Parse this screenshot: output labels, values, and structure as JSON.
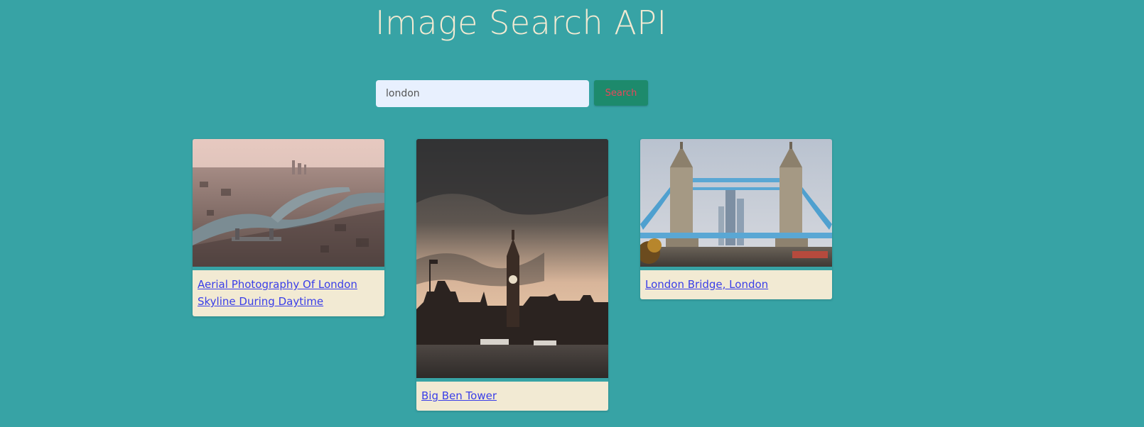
{
  "page": {
    "title": "Image Search API"
  },
  "search": {
    "value": "london",
    "button_label": "Search"
  },
  "results": [
    {
      "caption": "Aerial Photography Of London Skyline During Daytime"
    },
    {
      "caption": "Big Ben Tower"
    },
    {
      "caption": "London Bridge, London"
    }
  ],
  "colors": {
    "background": "#37a3a5",
    "title": "#f3ead2",
    "input_bg": "#e8f0fe",
    "button_bg": "#1d8a6c",
    "button_text": "#e8485a",
    "caption_bg": "#f2ead3",
    "link": "#3a3ee8"
  }
}
